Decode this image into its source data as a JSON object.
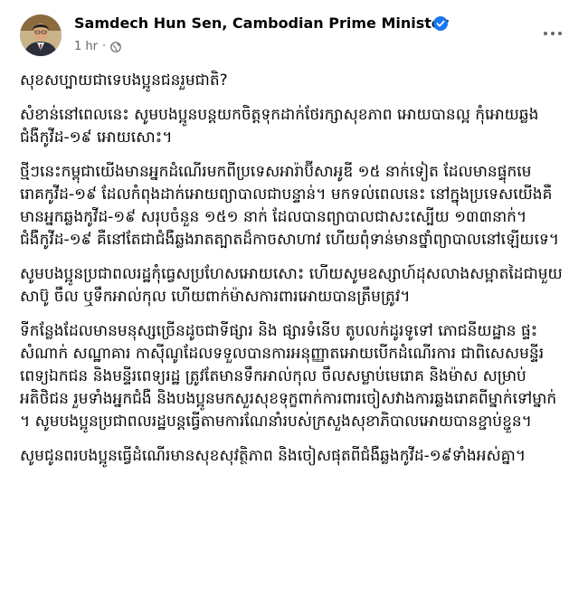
{
  "post": {
    "author": "Samdech Hun Sen, Cambodian Prime Minister",
    "verified_icon": "verified-badge-icon",
    "timestamp": "1 hr",
    "separator": "·",
    "privacy_icon": "globe-icon",
    "more_icon": "more-options-icon",
    "paragraphs": [
      "សុខសប្បាយជាទេបងប្អូនជនរួមជាតិ?",
      "សំខាន់នៅពេលនេះ សូមបងប្អូនបន្តយកចិត្តទុកដាក់ថែរក្សាសុខភាព អោយបានល្អ កុំអោយឆ្លងជំងឺកូវីដ-១៩ អោយសោះ។",
      "ថ្មីៗនេះកម្ពុជាយើងមានអ្នកដំណើរមកពីប្រទេសអារ៉ាប៊ីសាអូឌី ១៥ នាក់ទៀត ដែលមានផ្ទុកមេរោគកូវីដ-១៩ ដែលកំពុងដាក់អោយព្យាបាលជាបន្ទាន់។ មកទល់ពេលនេះ នៅក្នុងប្រទេសយើងគឺមានអ្នកឆ្លងកូវីដ-១៩ សរុបចំនួន ១៥១ នាក់ ដែលបានព្យាបាលជាសះស្បើយ ១៣៣នាក់។ ជំងឺកូវីដ-១៩ គឺនៅតែជាជំងឺឆ្លងរាតត្បាតដ៏កាចសាហាវ ហើយពុំទាន់មានថ្នាំព្យាបាលនៅឡើយទេ។",
      "សូមបងប្អូនប្រជាពលរដ្ឋកុំធ្វេសប្រហែសអោយសោះ ហើយសូមឧស្សាហ៍ដុសលាងសម្អាតដៃជាមួយសាប៊ូ ចឹល ឬទឹកអាល់កុល ហើយពាក់ម៉ាសការពារអោយបានត្រឹមត្រូវ។",
      "ទីកន្លែងដែលមានមនុស្សច្រើនដូចជាទីផ្សារ និង ផ្សារទំនើប តូបលក់ដូរទូទៅ ភោជនីយដ្ឋាន ផ្ទះសំណាក់ សណ្ឋាគារ កាស៊ីណូដែលទទួលបានការអនុញ្ញាតអោយបើកដំណើរការ ជាពិសេសមន្ទីរពេទ្យឯកជន និងមន្ទីរពេទ្យរដ្ឋ ត្រូវតែមានទឹកអាល់កុល ចឹលសម្លាប់មេរោគ និងម៉ាស សម្រាប់អតិថិជន រួមទាំងអ្នកជំងឺ និងបងប្អូនមកសួរសុខទុក្ខពាក់ការពារចៀសវាងការឆ្លងរោគពីម្នាក់ទៅម្នាក់ ។ សូមបងប្អូនប្រជាពលរដ្ឋបន្តធ្វើតាមការណែនាំរបស់ក្រសួងសុខាភិបាលអោយបានខ្ជាប់ខ្ជួន។",
      "សូមជូនពរបងប្អូនធ្វើដំណើរមានសុខសុវត្ថិភាព និងចៀសផុតពីជំងឺឆ្លងកូវីដ-១៩ទាំងអស់គ្នា។"
    ]
  }
}
